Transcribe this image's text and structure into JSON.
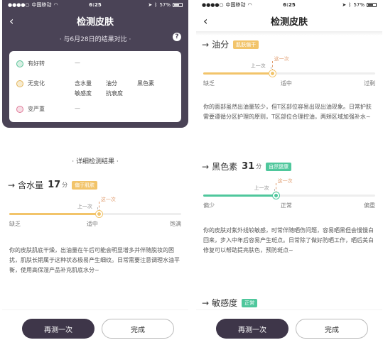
{
  "left": {
    "status": {
      "carrier": "中国移动",
      "time": "6:25",
      "battery": "57%"
    },
    "nav": {
      "title": "检测皮肤"
    },
    "compare_text": "· 与6月28日的结果对比 ·",
    "help": "?",
    "compare": [
      {
        "label": "有好转",
        "items": [],
        "dash": "—",
        "color": "green"
      },
      {
        "label": "无变化",
        "items": [
          "含水量",
          "油分",
          "黑色素",
          "敏感度",
          "抗衰度"
        ],
        "color": "yellow"
      },
      {
        "label": "变严重",
        "items": [],
        "dash": "—",
        "color": "red"
      }
    ],
    "section_title": "· 详细检测结果 ·",
    "metric": {
      "arrow": "→",
      "name": "含水量",
      "score": "17",
      "unit": "分",
      "tag": "偏于肌肤",
      "this_label": "这一次",
      "last_label": "上一次",
      "level": 0.52,
      "ticks": [
        "缺乏",
        "适中",
        "饱满"
      ],
      "desc": "你的皮肤肌底干燥，出油量在午后可能会明显增多并伴随脱妆的困扰，肌肤长期属于这种状态极易产生细纹。日常需要注意调理水油平衡，使用高保湿产品补充肌底水分~"
    },
    "buttons": {
      "retest": "再测一次",
      "done": "完成"
    }
  },
  "right": {
    "status": {
      "carrier": "中国移动",
      "time": "6:25",
      "battery": "57%"
    },
    "nav": {
      "title": "检测皮肤"
    },
    "oil": {
      "arrow": "→",
      "name": "油分",
      "tag": "肌肤偏干",
      "this_label": "这一次",
      "last_label": "上一次",
      "level": 0.4,
      "ticks": [
        "缺乏",
        "适中",
        "过剩"
      ],
      "desc": "你的面部虽然出油量较少，但T区部位容易出现出油现象。日常护肤需要遵循分区护理的原则，T区部位合理控油，两颊区域加强补水~"
    },
    "melanin": {
      "arrow": "→",
      "name": "黑色素",
      "score": "31",
      "unit": "分",
      "tag": "自然健康",
      "this_label": "这一次",
      "last_label": "上一次",
      "level": 0.42,
      "ticks": [
        "偏少",
        "正常",
        "偏重"
      ],
      "desc": "你的皮肤对紫外线较敏感，时常伴随晒伤问题，容易晒黑但会慢慢白回来，步入中年后容易产生斑点。日常除了做好防晒工作，晒后美白修复可以帮助提亮肤色，预防斑点~"
    },
    "sensitivity": {
      "arrow": "→",
      "name": "敏感度",
      "tag": "正常"
    },
    "buttons": {
      "retest": "再测一次",
      "done": "完成"
    }
  },
  "colors": {
    "header_dark": "#4a4356",
    "accent_yellow": "#f2c46a",
    "accent_green": "#4fc79c",
    "button_dark": "#3e3649"
  }
}
